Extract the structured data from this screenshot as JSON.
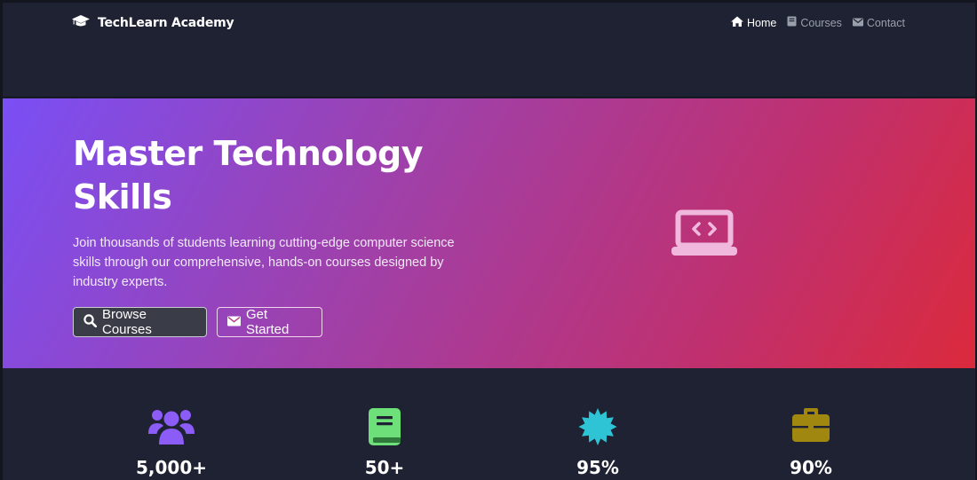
{
  "navbar": {
    "brand": "TechLearn Academy",
    "brand_icon": "graduation-cap-icon",
    "links": [
      {
        "label": "Home",
        "icon": "home-icon",
        "active": true
      },
      {
        "label": "Courses",
        "icon": "book-icon",
        "active": false
      },
      {
        "label": "Contact",
        "icon": "envelope-icon",
        "active": false
      }
    ]
  },
  "hero": {
    "title": "Master Technology Skills",
    "subtitle": "Join thousands of students learning cutting-edge computer science skills through our comprehensive, hands-on courses designed by industry experts.",
    "buttons": [
      {
        "label": "Browse Courses",
        "icon": "search-icon"
      },
      {
        "label": "Get Started",
        "icon": "envelope-icon"
      }
    ],
    "illustration_icon": "laptop-code-icon",
    "gradient": [
      "#7a4ff5",
      "#db2a3c"
    ]
  },
  "stats": [
    {
      "value": "5,000+",
      "icon": "users-icon",
      "color": "#8b5cf6"
    },
    {
      "value": "50+",
      "icon": "book-icon",
      "color": "#6ee07a"
    },
    {
      "value": "95%",
      "icon": "certificate-icon",
      "color": "#2ec4d6"
    },
    {
      "value": "90%",
      "icon": "briefcase-icon",
      "color": "#a08710"
    }
  ],
  "colors": {
    "background": "#1e2232",
    "nav_inactive": "#9aa0ab",
    "nav_active": "#ffffff"
  }
}
